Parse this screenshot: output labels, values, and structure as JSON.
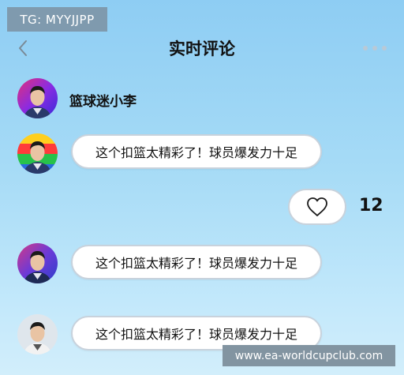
{
  "watermark_top": "TG: MYYJJPP",
  "header": {
    "title": "实时评论",
    "back_icon": "chevron-left-icon",
    "more_icon": "more-dots-icon"
  },
  "user": {
    "name": "篮球迷小李"
  },
  "comments": [
    {
      "text": "这个扣篮太精彩了！球员爆发力十足"
    },
    {
      "text": "这个扣篮太精彩了！球员爆发力十足"
    },
    {
      "text": "这个扣篮太精彩了！球员爆发力十足"
    }
  ],
  "like": {
    "icon": "heart-icon",
    "count": "12"
  },
  "watermark_bottom": "www.ea-worldcupclub.com",
  "colors": {
    "background_top": "#8ecdf3",
    "background_bottom": "#d2eefb",
    "bubble_border": "#c8d2dc"
  }
}
